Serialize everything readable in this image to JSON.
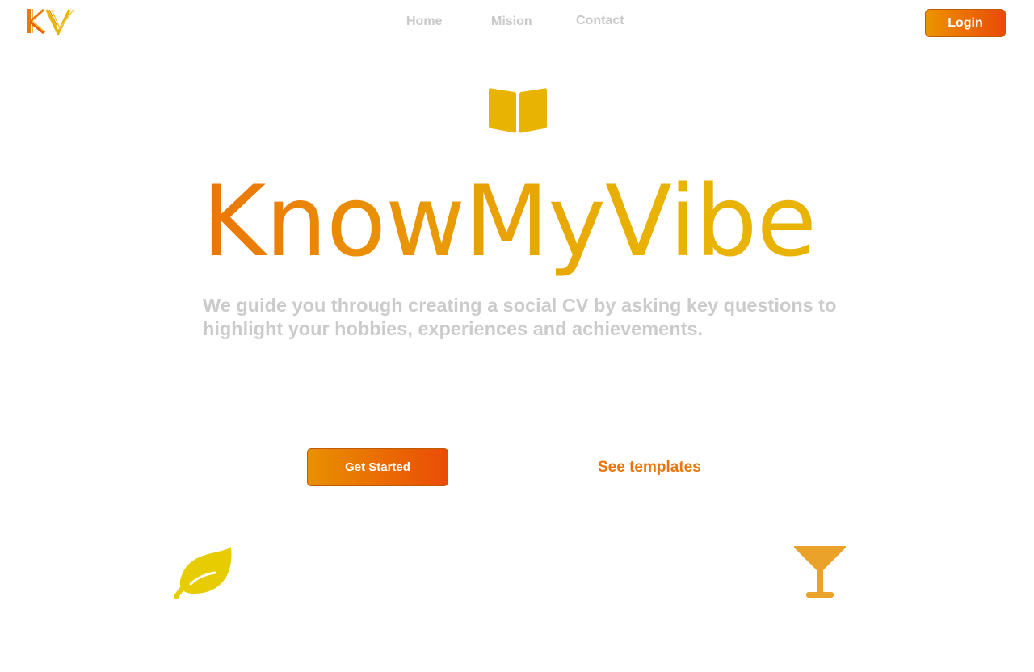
{
  "brand": {
    "logo_text": "KV"
  },
  "nav": {
    "home": "Home",
    "mision": "Mision",
    "contact": "Contact"
  },
  "header": {
    "login_label": "Login"
  },
  "hero": {
    "title": "KnowMyVibe",
    "subtitle": "We guide you through creating a social CV by asking key questions to highlight your hobbies, experiences and achievements."
  },
  "actions": {
    "get_started_label": "Get Started",
    "see_templates_label": "See templates"
  },
  "icons": {
    "hero_icon": "book-icon",
    "decor_left": "leaf-icon",
    "decor_right": "cocktail-glass-icon"
  },
  "colors": {
    "accent_orange": "#ea7608",
    "accent_yellow": "#e9b303",
    "leaf_yellow": "#e6cc00",
    "glass_orange": "#eba22a",
    "muted_text": "#c8c8c8"
  }
}
